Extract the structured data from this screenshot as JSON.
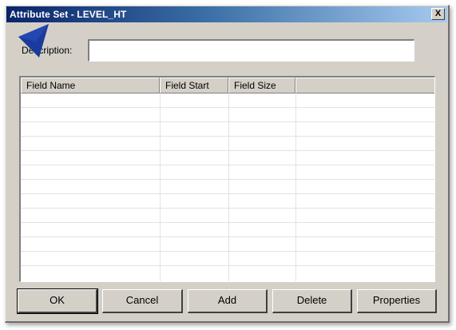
{
  "window": {
    "title": "Attribute Set - LEVEL_HT",
    "close_label": "X"
  },
  "description": {
    "label": "Description:",
    "value": ""
  },
  "grid": {
    "columns": [
      "Field Name",
      "Field Start",
      "Field Size",
      ""
    ],
    "rows": [
      [
        "",
        "",
        "",
        ""
      ],
      [
        "",
        "",
        "",
        ""
      ],
      [
        "",
        "",
        "",
        ""
      ],
      [
        "",
        "",
        "",
        ""
      ],
      [
        "",
        "",
        "",
        ""
      ],
      [
        "",
        "",
        "",
        ""
      ],
      [
        "",
        "",
        "",
        ""
      ],
      [
        "",
        "",
        "",
        ""
      ],
      [
        "",
        "",
        "",
        ""
      ],
      [
        "",
        "",
        "",
        ""
      ],
      [
        "",
        "",
        "",
        ""
      ],
      [
        "",
        "",
        "",
        ""
      ]
    ]
  },
  "buttons": {
    "ok": "OK",
    "cancel": "Cancel",
    "add": "Add",
    "delete": "Delete",
    "properties": "Properties"
  },
  "colors": {
    "title_bar": "#0a246a",
    "pointer": "#1b3b9c",
    "dialog_face": "#d4d0c8"
  }
}
